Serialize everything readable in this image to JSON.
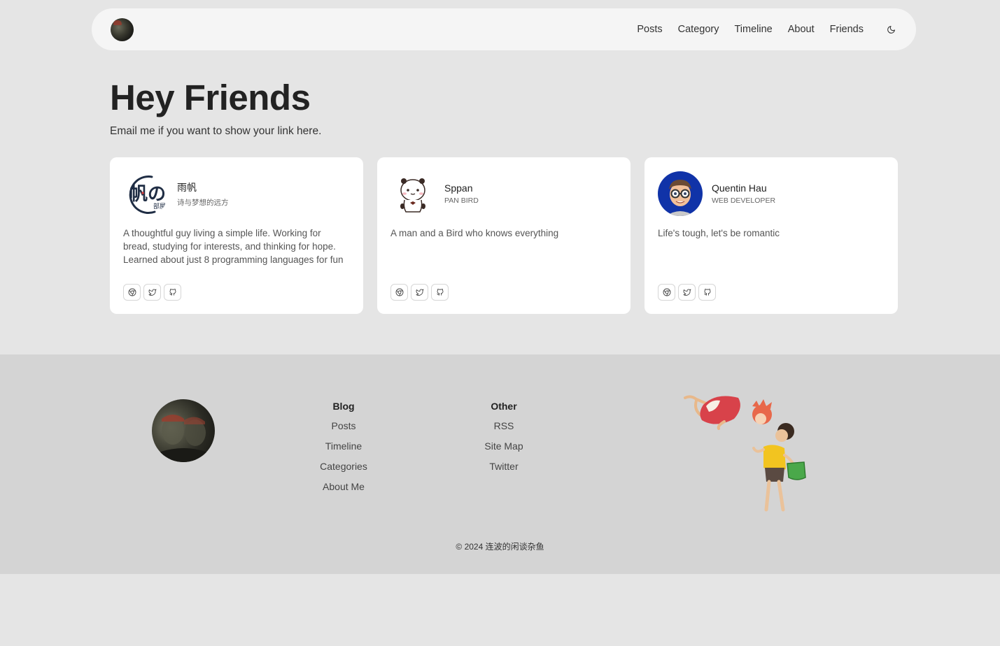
{
  "nav": {
    "links": [
      "Posts",
      "Category",
      "Timeline",
      "About",
      "Friends"
    ],
    "theme_icon": "moon-icon"
  },
  "hero": {
    "title": "Hey Friends",
    "subtitle": "Email me if you want to show your link here."
  },
  "cards": [
    {
      "name": "雨帆",
      "role": "诗与梦想的远方",
      "description": "A thoughtful guy living a simple life. Working for bread, studying for interests, and thinking for hope. Learned about just 8 programming languages for fun",
      "avatar_text": "帆の",
      "avatar_subtext": "部屋"
    },
    {
      "name": "Sppan",
      "role": "PAN BIRD",
      "description": "A man and a Bird who knows everything"
    },
    {
      "name": "Quentin Hau",
      "role": "WEB DEVELOPER",
      "description": "Life's tough, let's be romantic"
    }
  ],
  "card_icons": [
    "chrome-icon",
    "twitter-icon",
    "github-icon"
  ],
  "footer": {
    "blog": {
      "heading": "Blog",
      "items": [
        "Posts",
        "Timeline",
        "Categories",
        "About Me"
      ]
    },
    "other": {
      "heading": "Other",
      "items": [
        "RSS",
        "Site Map",
        "Twitter"
      ]
    },
    "copyright": "© 2024 连波的闲谈杂鱼"
  }
}
